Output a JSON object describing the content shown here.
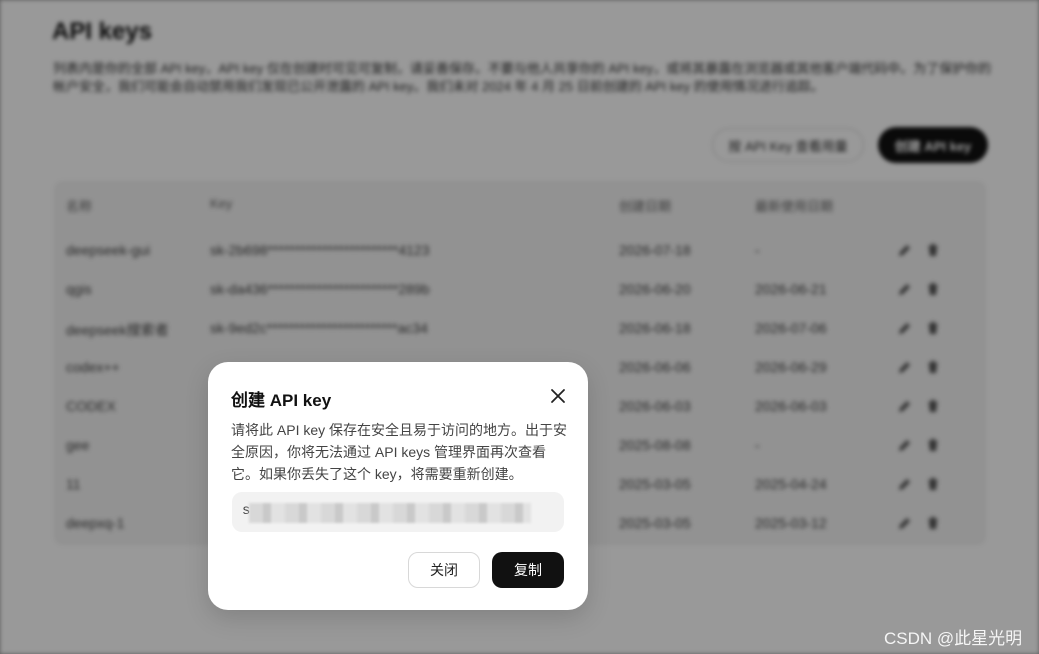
{
  "page": {
    "title": "API keys",
    "description": "列表内是你的全部 API key，API key 仅在创建时可见可复制，请妥善保存。不要与他人共享你的 API key，或将其暴露在浏览器或其他客户端代码中。为了保护你的帐户安全，我们可能会自动禁用我们发现已公开泄露的 API key。我们未对 2024 年 4 月 25 日前创建的 API key 的使用情况进行追踪。",
    "usage_button": "按 API Key 查看用量",
    "create_button": "创建 API key"
  },
  "table": {
    "headers": [
      "名称",
      "Key",
      "创建日期",
      "最新使用日期"
    ],
    "rows": [
      {
        "name": "deepseek-gui",
        "key": "sk-2b698************************4123",
        "created": "2026-07-18",
        "last_used": "-"
      },
      {
        "name": "qgis",
        "key": "sk-da436************************289b",
        "created": "2026-06-20",
        "last_used": "2026-06-21"
      },
      {
        "name": "deepseek搜索者",
        "key": "sk-9ed2c************************ac34",
        "created": "2026-06-18",
        "last_used": "2026-07-06"
      },
      {
        "name": "codex++",
        "key": "",
        "created": "2026-06-06",
        "last_used": "2026-06-29"
      },
      {
        "name": "CODEX",
        "key": "",
        "created": "2026-06-03",
        "last_used": "2026-06-03"
      },
      {
        "name": "gee",
        "key": "",
        "created": "2025-08-08",
        "last_used": "-"
      },
      {
        "name": "11",
        "key": "",
        "created": "2025-03-05",
        "last_used": "2025-04-24"
      },
      {
        "name": "deepxq-1",
        "key": "",
        "created": "2025-03-05",
        "last_used": "2025-03-12"
      }
    ]
  },
  "dialog": {
    "title": "创建 API key",
    "text": "请将此 API key 保存在安全且易于访问的地方。出于安全原因，你将无法通过 API keys 管理界面再次查看它。如果你丢失了这个 key，将需要重新创建。",
    "key_prefix": "s",
    "close_label": "关闭",
    "copy_label": "复制"
  },
  "watermark": "CSDN @此星光明",
  "icons": {
    "edit": "pencil-icon",
    "delete": "trash-icon",
    "close": "close-icon"
  },
  "colors": {
    "overlay": "#9c9c9c",
    "primary_button": "#111111",
    "dialog_bg": "#ffffff"
  }
}
